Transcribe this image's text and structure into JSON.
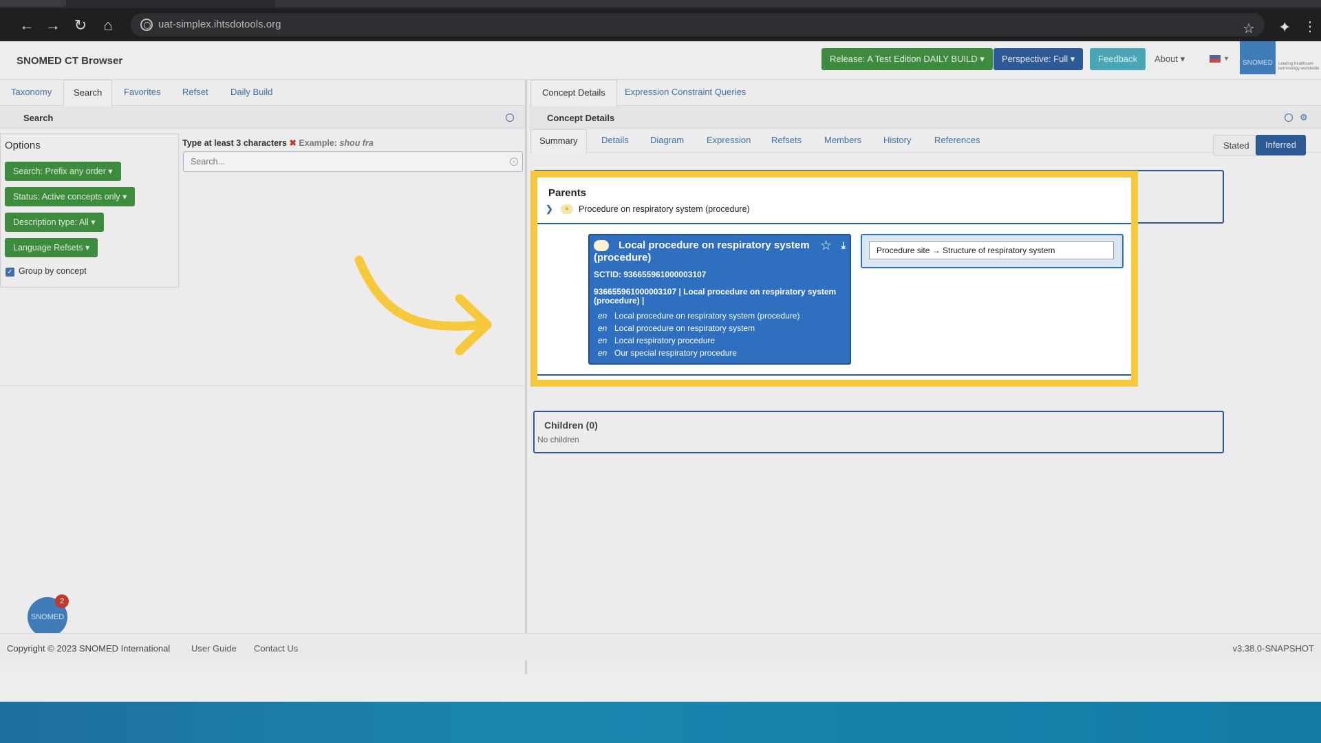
{
  "browser": {
    "url": "uat-simplex.ihtsdotools.org"
  },
  "app": {
    "title": "SNOMED CT Browser",
    "release_label": "Release: A Test Edition DAILY BUILD ▾",
    "perspective_label": "Perspective: Full ▾",
    "feedback_label": "Feedback",
    "about_label": "About ▾",
    "logo_text": "SNOMED",
    "logo_tagline": "Leading healthcare terminology worldwide"
  },
  "left": {
    "tabs": [
      "Taxonomy",
      "Search",
      "Favorites",
      "Refset",
      "Daily Build"
    ],
    "section_title": "Search",
    "options_title": "Options",
    "option_buttons": [
      "Search: Prefix any order ▾",
      "Status: Active concepts only ▾",
      "Description type: All ▾",
      "Language Refsets ▾"
    ],
    "group_by_label": "Group by concept",
    "hint_prefix": "Type at least 3 characters",
    "hint_example_label": "Example:",
    "hint_example_value": "shou fra",
    "search_placeholder": "Search...",
    "bubble_text": "SNOMED",
    "bubble_badge": "2"
  },
  "right": {
    "tabs": [
      "Concept Details",
      "Expression Constraint Queries"
    ],
    "section_title": "Concept Details",
    "subtabs": [
      "Summary",
      "Details",
      "Diagram",
      "Expression",
      "Refsets",
      "Members",
      "History",
      "References"
    ],
    "toggle_stated": "Stated",
    "toggle_inferred": "Inferred",
    "children_label": "Children (0)",
    "no_children": "No children"
  },
  "focus": {
    "parents_title": "Parents",
    "parent_primitive": "≡",
    "parent_label": "Procedure on respiratory system (procedure)",
    "concept_title": "Local procedure on respiratory system (procedure)",
    "sctid_line": "SCTID: 936655961000003107",
    "fsn_line": "936655961000003107 | Local procedure on respiratory system (procedure) |",
    "descriptions": [
      {
        "lang": "en",
        "text": "Local procedure on respiratory system (procedure)"
      },
      {
        "lang": "en",
        "text": "Local procedure on respiratory system"
      },
      {
        "lang": "en",
        "text": "Local respiratory procedure"
      },
      {
        "lang": "en",
        "text": "Our special respiratory procedure"
      }
    ],
    "attribute": "Procedure site → Structure of respiratory system"
  },
  "footer": {
    "copyright": "Copyright © 2023 SNOMED International",
    "user_guide": "User Guide",
    "contact": "Contact Us",
    "version": "v3.38.0-SNAPSHOT"
  },
  "colors": {
    "highlight": "#f6c93d",
    "primary_blue": "#2f6fbf",
    "green": "#3d8c3d"
  }
}
